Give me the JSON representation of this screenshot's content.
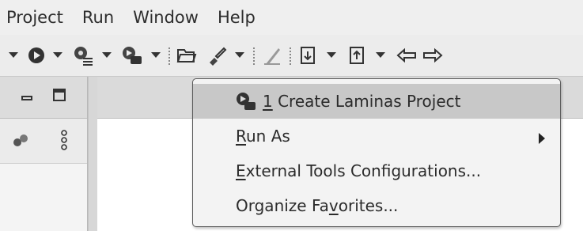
{
  "menubar": {
    "items": [
      {
        "label": "Project"
      },
      {
        "label": "Run"
      },
      {
        "label": "Window"
      },
      {
        "label": "Help"
      }
    ]
  },
  "toolbar": {
    "icons": [
      "chevron-down-icon",
      "run-icon",
      "coverage-icon",
      "laminas-run-icon",
      "open-folder-icon",
      "brush-icon",
      "pen-icon",
      "annotation-icon",
      "annotation-up-icon",
      "back-icon",
      "forward-icon"
    ]
  },
  "menu": {
    "items": [
      {
        "mnemonic": "1",
        "label": " Create Laminas Project",
        "icon": "laminas-project-icon",
        "highlighted": true
      },
      {
        "mnemonic": "R",
        "label": "un As",
        "submenu": true
      },
      {
        "mnemonic": "E",
        "label": "xternal Tools Configurations..."
      },
      {
        "pre": "Organize Fa",
        "mnemonic": "v",
        "label": "orites..."
      }
    ]
  },
  "colors": {
    "menu_bg": "#f3f3f3",
    "highlight_bg": "#c8c8c8",
    "menu_border": "#5a5a5a"
  }
}
